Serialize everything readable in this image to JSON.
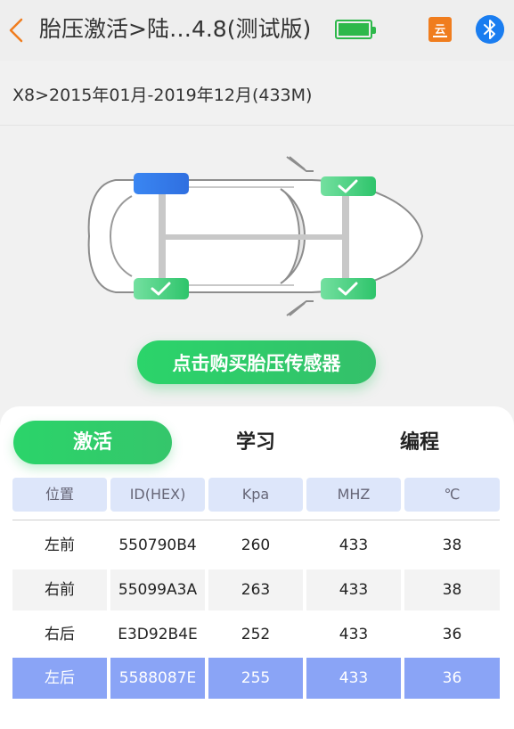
{
  "header": {
    "title": "胎压激活>陆…4.8(测试版)",
    "icons": [
      "back-chevron-icon",
      "battery-full-icon",
      "report-icon",
      "bluetooth-icon"
    ],
    "report_icon_label": "云"
  },
  "vehicle": {
    "info": "X8>2015年01月-2019年12月(433M)"
  },
  "buy_button": {
    "label": "点击购买胎压传感器"
  },
  "tabs": [
    {
      "label": "激活",
      "active": true
    },
    {
      "label": "学习",
      "active": false
    },
    {
      "label": "编程",
      "active": false
    }
  ],
  "table": {
    "headers": [
      "位置",
      "ID(HEX)",
      "Kpa",
      "MHZ",
      "℃"
    ],
    "rows": [
      [
        "左前",
        "550790B4",
        "260",
        "433",
        "38"
      ],
      [
        "右前",
        "55099A3A",
        "263",
        "433",
        "38"
      ],
      [
        "右后",
        "E3D92B4E",
        "252",
        "433",
        "36"
      ],
      [
        "左后",
        "5588087E",
        "255",
        "433",
        "36"
      ]
    ],
    "selected_row": 3
  },
  "colors": {
    "accent_green": "#2ed16b",
    "selected_row": "#8aa4f6",
    "header_bg": "#dde6fa",
    "back_orange": "#f07d1e",
    "bluetooth_blue": "#1a7df0"
  }
}
